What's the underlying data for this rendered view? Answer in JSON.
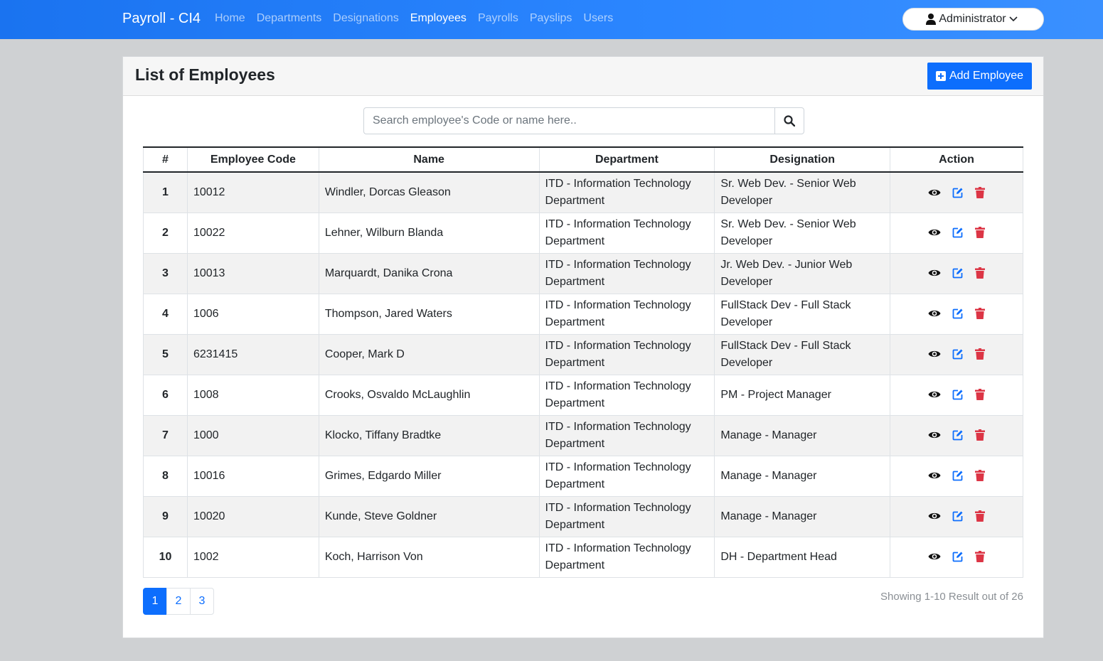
{
  "app": {
    "brand": "Payroll - CI4"
  },
  "nav": {
    "links": [
      {
        "label": "Home",
        "active": false
      },
      {
        "label": "Departments",
        "active": false
      },
      {
        "label": "Designations",
        "active": false
      },
      {
        "label": "Employees",
        "active": true
      },
      {
        "label": "Payrolls",
        "active": false
      },
      {
        "label": "Payslips",
        "active": false
      },
      {
        "label": "Users",
        "active": false
      }
    ],
    "user_label": "Administrator"
  },
  "card": {
    "title": "List of Employees",
    "add_label": "Add Employee"
  },
  "search": {
    "placeholder": "Search employee's Code or name here..",
    "value": ""
  },
  "table": {
    "headers": [
      "#",
      "Employee Code",
      "Name",
      "Department",
      "Designation",
      "Action"
    ],
    "rows": [
      {
        "num": "1",
        "code": "10012",
        "name": "Windler, Dorcas Gleason",
        "department": "ITD - Information Technology Department",
        "designation": "Sr. Web Dev. - Senior Web Developer"
      },
      {
        "num": "2",
        "code": "10022",
        "name": "Lehner, Wilburn Blanda",
        "department": "ITD - Information Technology Department",
        "designation": "Sr. Web Dev. - Senior Web Developer"
      },
      {
        "num": "3",
        "code": "10013",
        "name": "Marquardt, Danika Crona",
        "department": "ITD - Information Technology Department",
        "designation": "Jr. Web Dev. - Junior Web Developer"
      },
      {
        "num": "4",
        "code": "1006",
        "name": "Thompson, Jared Waters",
        "department": "ITD - Information Technology Department",
        "designation": "FullStack Dev - Full Stack Developer"
      },
      {
        "num": "5",
        "code": "6231415",
        "name": "Cooper, Mark D",
        "department": "ITD - Information Technology Department",
        "designation": "FullStack Dev - Full Stack Developer"
      },
      {
        "num": "6",
        "code": "1008",
        "name": "Crooks, Osvaldo McLaughlin",
        "department": "ITD - Information Technology Department",
        "designation": "PM - Project Manager"
      },
      {
        "num": "7",
        "code": "1000",
        "name": "Klocko, Tiffany Bradtke",
        "department": "ITD - Information Technology Department",
        "designation": "Manage - Manager"
      },
      {
        "num": "8",
        "code": "10016",
        "name": "Grimes, Edgardo Miller",
        "department": "ITD - Information Technology Department",
        "designation": "Manage - Manager"
      },
      {
        "num": "9",
        "code": "10020",
        "name": "Kunde, Steve Goldner",
        "department": "ITD - Information Technology Department",
        "designation": "Manage - Manager"
      },
      {
        "num": "10",
        "code": "1002",
        "name": "Koch, Harrison Von",
        "department": "ITD - Information Technology Department",
        "designation": "DH - Department Head"
      }
    ],
    "action_icons": [
      "eye-icon",
      "edit-icon",
      "trash-icon"
    ]
  },
  "pagination": {
    "pages": [
      "1",
      "2",
      "3"
    ],
    "active": "1",
    "showing": "Showing 1-10 Result out of 26"
  },
  "colors": {
    "primary": "#0d6efd",
    "navbar": "#2b86ff",
    "danger": "#dc3545",
    "dark": "#212529"
  }
}
